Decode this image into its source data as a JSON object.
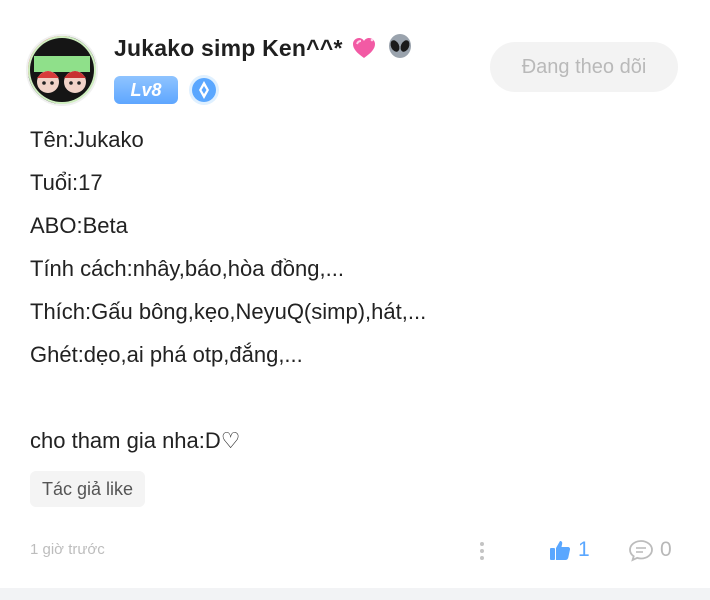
{
  "post": {
    "author": {
      "name": "Jukako simp Ken^^*",
      "emoji_heart_icon": "sparkling-heart-icon",
      "emoji_alien_icon": "alien-icon",
      "level_label": "Lv8",
      "title_icon": "droplet-badge-icon"
    },
    "follow_button_label": "Đang theo dõi",
    "content": {
      "lines": [
        "Tên:Jukako",
        "Tuổi:17",
        "ABO:Beta",
        "Tính cách:nhây,báo,hòa đồng,...",
        "Thích:Gấu bông,kẹo,NeyuQ(simp),hát,...",
        "Ghét:dẹo,ai phá otp,đắng,..."
      ],
      "closing": "cho tham gia nha:D♡"
    },
    "tag_label": "Tác giả like",
    "timestamp": "1 giờ trước",
    "likes": "1",
    "comments": "0",
    "colors": {
      "accent_blue": "#5aa7ff",
      "level_badge": "#6aaeff",
      "follow_bg": "#f3f3f3",
      "follow_text": "#b9b9b9"
    }
  }
}
